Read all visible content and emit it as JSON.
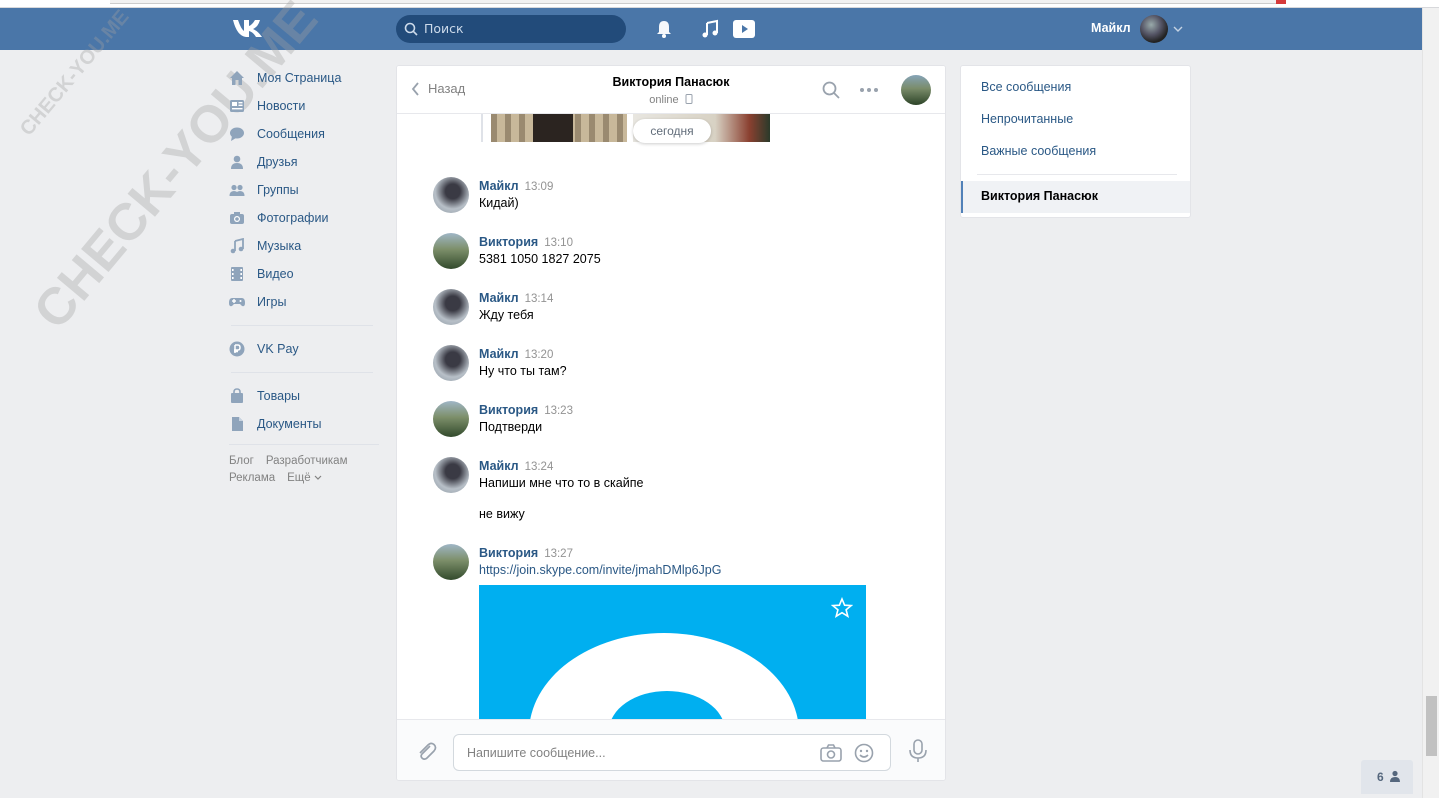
{
  "watermark": {
    "small": "CHECK-YOU.ME",
    "large": "CHECK-YOU.ME"
  },
  "header": {
    "search_placeholder": "Поиск",
    "user_name": "Майкл"
  },
  "left_nav": {
    "items": [
      {
        "label": "Моя Страница",
        "icon": "home-icon"
      },
      {
        "label": "Новости",
        "icon": "news-icon"
      },
      {
        "label": "Сообщения",
        "icon": "messages-icon"
      },
      {
        "label": "Друзья",
        "icon": "friends-icon"
      },
      {
        "label": "Группы",
        "icon": "groups-icon"
      },
      {
        "label": "Фотографии",
        "icon": "camera-icon"
      },
      {
        "label": "Музыка",
        "icon": "music-icon"
      },
      {
        "label": "Видео",
        "icon": "video-icon"
      },
      {
        "label": "Игры",
        "icon": "gamepad-icon"
      }
    ],
    "vkpay": "VK Pay",
    "extra": [
      {
        "label": "Товары",
        "icon": "bag-icon"
      },
      {
        "label": "Документы",
        "icon": "document-icon"
      }
    ],
    "footer": {
      "blog": "Блог",
      "developers": "Разработчикам",
      "ads": "Реклама",
      "more": "Ещё"
    }
  },
  "chat": {
    "back_label": "Назад",
    "peer_name": "Виктория Панасюк",
    "peer_status": "online",
    "date_divider": "сегодня",
    "messages": [
      {
        "author": "Майкл",
        "time": "13:09",
        "text": "Кидай)",
        "avatar": "maikl"
      },
      {
        "author": "Виктория",
        "time": "13:10",
        "text": "5381 1050 1827 2075",
        "avatar": "vika"
      },
      {
        "author": "Майкл",
        "time": "13:14",
        "text": "Жду тебя",
        "avatar": "maikl"
      },
      {
        "author": "Майкл",
        "time": "13:20",
        "text": "Ну что ты там?",
        "avatar": "maikl"
      },
      {
        "author": "Виктория",
        "time": "13:23",
        "text": "Подтверди",
        "avatar": "vika"
      },
      {
        "author": "Майкл",
        "time": "13:24",
        "text": "Напиши мне что то в скайпе",
        "text2": "не вижу",
        "avatar": "maikl"
      },
      {
        "author": "Виктория",
        "time": "13:27",
        "text": "https://join.skype.com/invite/jmahDMlp6JpG",
        "avatar": "vika",
        "is_link": true
      }
    ],
    "composer_placeholder": "Напишите сообщение..."
  },
  "right_panel": {
    "all_messages": "Все сообщения",
    "unread": "Непрочитанные",
    "important": "Важные сообщения",
    "active_conversation": "Виктория Панасюк"
  },
  "online_widget": {
    "count": "6"
  },
  "colors": {
    "header_bg": "#4a76a8",
    "link": "#2a5885",
    "page_bg": "#edeef0",
    "skype_blue": "#00aff0"
  }
}
